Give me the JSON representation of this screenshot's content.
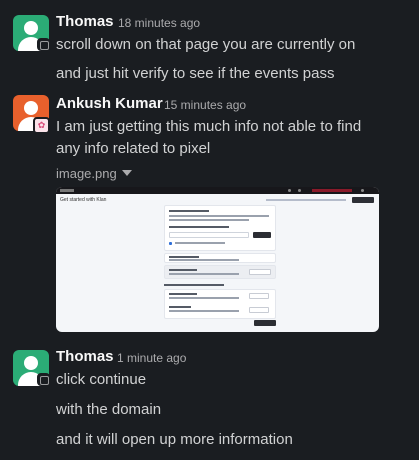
{
  "messages": [
    {
      "author": "Thomas",
      "time": "18 minutes ago",
      "lines": [
        "scroll down on that page you are currently on",
        "and just hit verify to see if the events pass"
      ]
    },
    {
      "author": "Ankush Kumar",
      "time": "15 minutes ago",
      "lines": [
        "I am just getting this much info not able to find",
        "any info related to pixel"
      ],
      "attachment": {
        "filename": "image.png",
        "title": "Get started with Klan"
      }
    },
    {
      "author": "Thomas",
      "time": "1 minute ago",
      "lines": [
        "click continue",
        "with the domain",
        "and it will open up more information"
      ]
    }
  ],
  "colors": {
    "background": "#1a1d21",
    "avatar_thomas": "#2bac76",
    "avatar_ankush": "#e8602c",
    "text": "#d1d2d3",
    "name": "#f8f8f8",
    "muted": "#ababad"
  },
  "icons": {
    "avatar": "person-silhouette-icon",
    "status": "square-status-icon",
    "status_emoji": "flower-emoji-icon",
    "caret": "caret-down-icon"
  }
}
